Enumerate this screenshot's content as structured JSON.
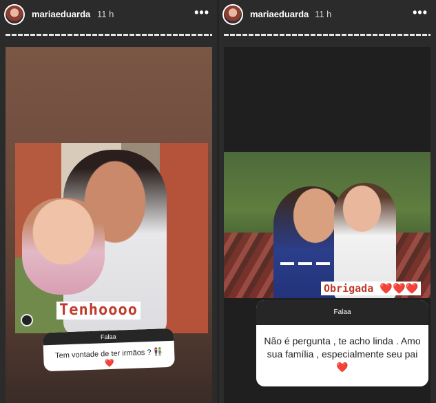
{
  "stories": {
    "left": {
      "username": "mariaeduarda",
      "time": "11 h",
      "more": "•••",
      "sticker_text": "Tenhoooo",
      "question": {
        "header": "Falaa",
        "text": "Tem vontade de ter irmãos ? 👫",
        "heart": "❤️"
      }
    },
    "right": {
      "username": "mariaeduarda",
      "time": "11 h",
      "more": "•••",
      "sticker_text": "Obrigada ❤️❤️❤️",
      "question": {
        "header": "Falaa",
        "text": "Não é pergunta , te acho linda . Amo sua família , especialmente seu pai",
        "heart": "❤️"
      }
    }
  },
  "icons": {
    "avatar": "profile-avatar",
    "more": "more-options-icon",
    "camera": "camera-icon"
  }
}
